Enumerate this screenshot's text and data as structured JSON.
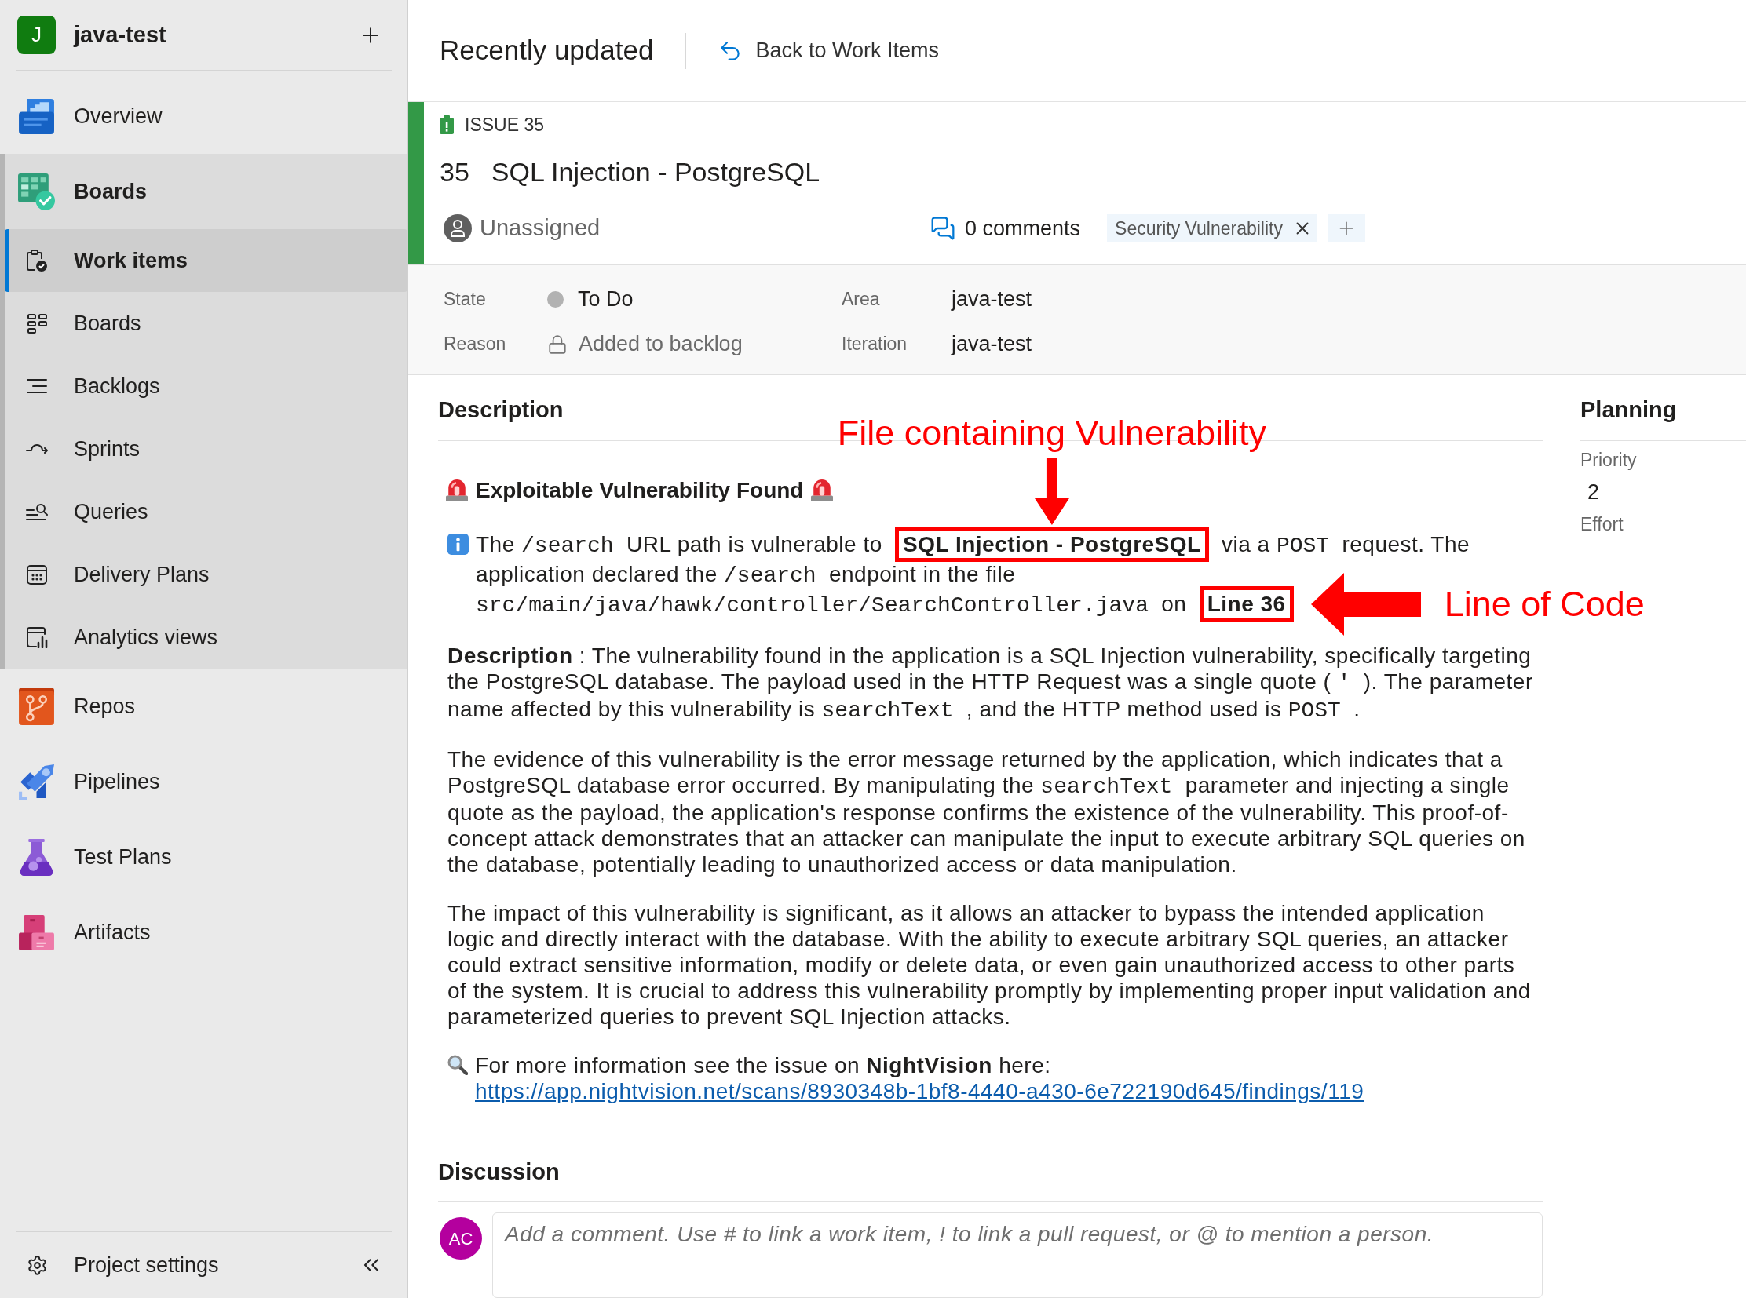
{
  "project": {
    "initial": "J",
    "name": "java-test"
  },
  "nav": [
    {
      "label": "Overview",
      "selected": false,
      "expanded": false
    },
    {
      "label": "Boards",
      "selected": false,
      "expanded": true,
      "children": [
        {
          "label": "Work items",
          "selected": true
        },
        {
          "label": "Boards",
          "selected": false
        },
        {
          "label": "Backlogs",
          "selected": false
        },
        {
          "label": "Sprints",
          "selected": false
        },
        {
          "label": "Queries",
          "selected": false
        },
        {
          "label": "Delivery Plans",
          "selected": false
        },
        {
          "label": "Analytics views",
          "selected": false
        }
      ]
    },
    {
      "label": "Repos",
      "selected": false,
      "expanded": false
    },
    {
      "label": "Pipelines",
      "selected": false,
      "expanded": false
    },
    {
      "label": "Test Plans",
      "selected": false,
      "expanded": false
    },
    {
      "label": "Artifacts",
      "selected": false,
      "expanded": false
    }
  ],
  "project_settings": "Project settings",
  "header": {
    "title": "Recently updated",
    "back_link": "Back to Work Items"
  },
  "work_item": {
    "type": "ISSUE 35",
    "id": "35",
    "title": "SQL Injection - PostgreSQL",
    "assignee": "Unassigned",
    "comments": "0 comments",
    "tags": [
      {
        "label": "Security Vulnerability"
      }
    ],
    "fields": [
      {
        "label": "State",
        "value": "To Do",
        "kind": "state"
      },
      {
        "label": "Area",
        "value": "java-test",
        "kind": "path"
      },
      {
        "label": "Reason",
        "value": "Added to backlog",
        "kind": "locked"
      },
      {
        "label": "Iteration",
        "value": "java-test",
        "kind": "path"
      }
    ]
  },
  "description": {
    "heading": "Description",
    "title": "Exploitable Vulnerability Found",
    "paragraphs": [
      {
        "kind": "info",
        "segments": [
          {
            "kind": "text",
            "text": "The "
          },
          {
            "kind": "code",
            "text": "/search"
          },
          {
            "kind": "text",
            "text": " URL path is vulnerable to "
          },
          {
            "kind": "bold",
            "text": "SQL Injection - PostgreSQL",
            "marked": true,
            "callout": {
              "kind": "above",
              "text": "File containing Vulnerability"
            }
          },
          {
            "kind": "text",
            "text": " via a "
          },
          {
            "kind": "code",
            "text": "POST"
          },
          {
            "kind": "text",
            "text": " request. The application declared the "
          },
          {
            "kind": "code",
            "text": "/search"
          },
          {
            "kind": "text",
            "text": " endpoint in the file "
          },
          {
            "kind": "code",
            "text": "src/main/java/hawk/controller/SearchController.java"
          },
          {
            "kind": "text",
            "text": " on "
          },
          {
            "kind": "bold",
            "text": "Line 36",
            "marked": true,
            "callout": {
              "kind": "beside",
              "text": "Line of Code"
            }
          }
        ]
      },
      {
        "kind": "plain",
        "segments": [
          {
            "kind": "bold",
            "text": "Description"
          },
          {
            "kind": "text",
            "text": " : The vulnerability found in the application is a SQL Injection vulnerability, specifically targeting the PostgreSQL database. The payload used in the HTTP Request was a single quote ( "
          },
          {
            "kind": "code",
            "text": "'"
          },
          {
            "kind": "text",
            "text": " ). The parameter name affected by this vulnerability is "
          },
          {
            "kind": "code",
            "text": "searchText"
          },
          {
            "kind": "text",
            "text": " , and the HTTP method used is "
          },
          {
            "kind": "code",
            "text": "POST"
          },
          {
            "kind": "text",
            "text": " ."
          }
        ]
      },
      {
        "kind": "plain",
        "segments": [
          {
            "kind": "text",
            "text": "The evidence of this vulnerability is the error message returned by the application, which indicates that a PostgreSQL database error occurred. By manipulating the "
          },
          {
            "kind": "code",
            "text": "searchText"
          },
          {
            "kind": "text",
            "text": " parameter and injecting a single quote as the payload, the application's response confirms the existence of the vulnerability. This proof-of-concept attack demonstrates that an attacker can manipulate the input to execute arbitrary SQL queries on the database, potentially leading to unauthorized access or data manipulation."
          }
        ]
      },
      {
        "kind": "plain",
        "segments": [
          {
            "kind": "text",
            "text": "The impact of this vulnerability is significant, as it allows an attacker to bypass the intended application logic and directly interact with the database. With the ability to execute arbitrary SQL queries, an attacker could extract sensitive information, modify or delete data, or even gain unauthorized access to other parts of the system. It is crucial to address this vulnerability promptly by implementing proper input validation and parameterized queries to prevent SQL Injection attacks."
          }
        ]
      },
      {
        "kind": "lookup",
        "segments": [
          {
            "kind": "text",
            "text": "For more information see the issue on "
          },
          {
            "kind": "bold",
            "text": "NightVision"
          },
          {
            "kind": "text",
            "text": " here: "
          },
          {
            "kind": "link",
            "text": "https://app.nightvision.net/scans/8930348b-1bf8-4440-a430-6e722190d645/findings/119"
          }
        ]
      }
    ]
  },
  "planning": {
    "heading": "Planning",
    "fields": [
      {
        "label": "Priority",
        "value": "2"
      },
      {
        "label": "Effort"
      }
    ]
  },
  "discussion": {
    "heading": "Discussion",
    "avatar": "AC",
    "placeholder": "Add a comment. Use # to link a work item, ! to link a pull request, or @ to mention a person."
  }
}
